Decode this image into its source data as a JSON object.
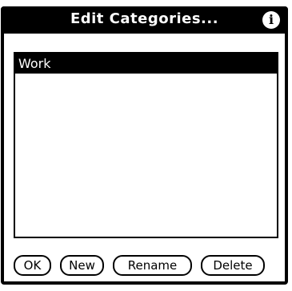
{
  "dialog": {
    "title": "Edit Categories...",
    "info_icon": "info-icon"
  },
  "categories": {
    "items": [
      {
        "label": "Work",
        "selected": true
      }
    ]
  },
  "buttons": {
    "ok_label": "OK",
    "new_label": "New",
    "rename_label": "Rename",
    "delete_label": "Delete"
  }
}
